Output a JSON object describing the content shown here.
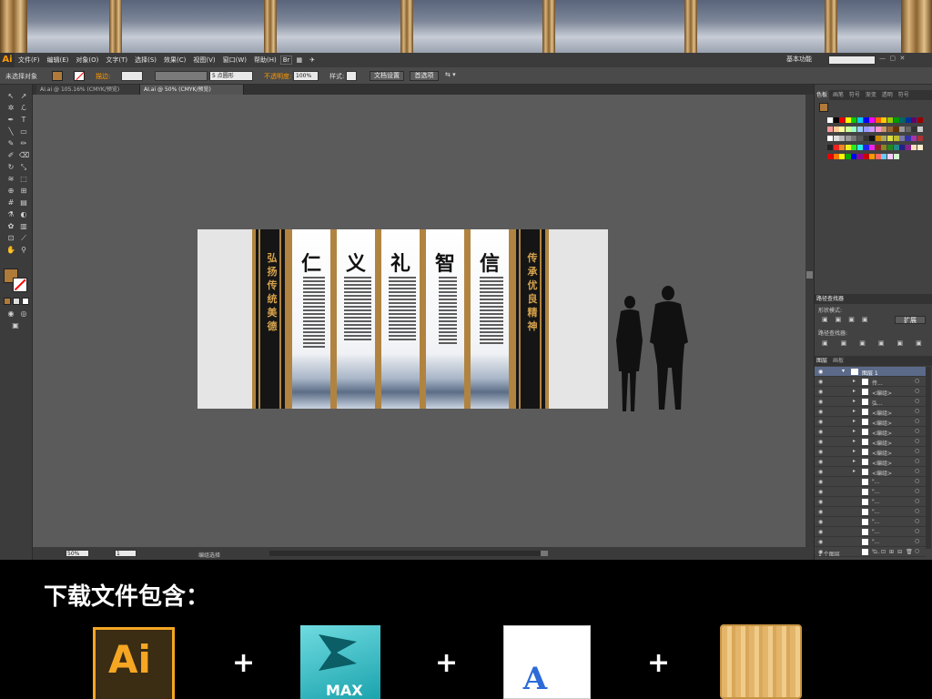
{
  "menubar": {
    "app_logo": "Ai",
    "items": [
      "文件(F)",
      "编辑(E)",
      "对象(O)",
      "文字(T)",
      "选择(S)",
      "效果(C)",
      "视图(V)",
      "窗口(W)",
      "帮助(H)"
    ],
    "workspace": "基本功能"
  },
  "control_bar": {
    "selection_label": "未选择对象",
    "stroke_label": "描边:",
    "brush_value": "5 点圆形",
    "opacity_label": "不透明度:",
    "opacity_value": "100%",
    "style_label": "样式:",
    "doc_setup_button": "文档设置",
    "prefs_button": "首选项"
  },
  "tabs": [
    {
      "label": "AI.ai @ 105.16% (CMYK/预览)"
    },
    {
      "label": "AI.ai @ 50% (CMYK/预览)"
    }
  ],
  "artboard": {
    "left_banner_text": "弘扬传统美德",
    "right_banner_text": "传承优良精神",
    "panel_chars": [
      "仁",
      "义",
      "礼",
      "智",
      "信"
    ]
  },
  "status_bar": {
    "zoom": "50%",
    "page": "1",
    "tool_hint": "编组选择"
  },
  "right_panel": {
    "swatch_tabs": [
      "色板",
      "画笔",
      "符号",
      "渐变",
      "透明",
      "符号"
    ],
    "pathfinder": {
      "title": "路径查找器",
      "shape_modes": "形状模式:",
      "expand_button": "扩展",
      "pathfinders_label": "路径查找器:"
    },
    "layers": {
      "tabs": [
        "图层",
        "画板"
      ],
      "layer_name": "图层 1",
      "rows": [
        "传...",
        "<编组>",
        "弘...",
        "<编组>",
        "<编组>",
        "<编组>",
        "<编组>",
        "<编组>",
        "<编组>",
        "<编组>",
        "\"...",
        "\"...",
        "\"...",
        "\"...",
        "\"...",
        "\"...",
        "\"...",
        "\"..."
      ],
      "footer": "1 个图层"
    }
  },
  "promo": {
    "title": "下载文件包含：",
    "items": [
      {
        "label": "Ai"
      },
      {
        "label": "MAX"
      },
      {
        "label": "A"
      },
      {
        "label": ""
      }
    ],
    "plus": "+"
  },
  "colors": {
    "ui_dark": "#3b3b3b",
    "canvas": "#5b5b5b",
    "gold": "#b08440",
    "ai_orange": "#ff9a00"
  }
}
